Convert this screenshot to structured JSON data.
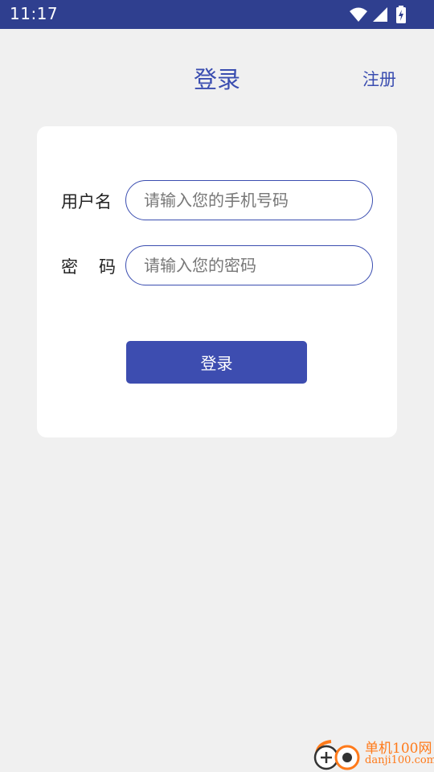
{
  "status_bar": {
    "time": "11:17",
    "icons": [
      "wifi-icon",
      "cellular-signal-icon",
      "battery-charging-icon"
    ],
    "background": "#2f3f8f"
  },
  "header": {
    "title": "登录",
    "register_label": "注册"
  },
  "form": {
    "username": {
      "label": "用户名",
      "placeholder": "请输入您的手机号码",
      "value": ""
    },
    "password": {
      "label_chars": [
        "密",
        "码"
      ],
      "placeholder": "请输入您的密码",
      "value": ""
    },
    "submit_label": "登录"
  },
  "watermark": {
    "name": "单机100网",
    "url": "danji100.com"
  },
  "colors": {
    "accent": "#3a4db0",
    "button": "#3d4db0",
    "background": "#f0f0f0",
    "card": "#ffffff",
    "watermark": "#ff7a1a"
  }
}
